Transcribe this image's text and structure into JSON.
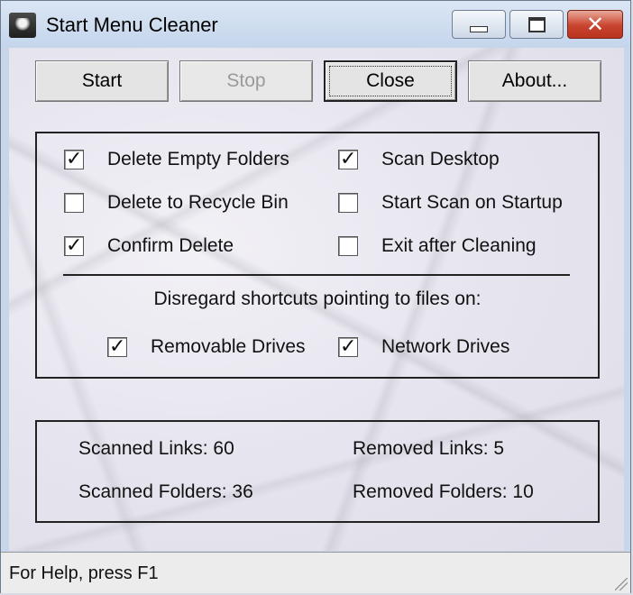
{
  "window": {
    "title": "Start Menu Cleaner",
    "caption_buttons": [
      "minimize-icon",
      "maximize-icon",
      "close-icon"
    ],
    "close_glyph": "✕"
  },
  "toolbar": {
    "start_label": "Start",
    "stop_label": "Stop",
    "close_label": "Close",
    "about_label": "About..."
  },
  "options": {
    "delete_empty_folders": {
      "label": "Delete Empty Folders",
      "checked": true
    },
    "scan_desktop": {
      "label": "Scan Desktop",
      "checked": true
    },
    "delete_to_recycle_bin": {
      "label": "Delete to Recycle Bin",
      "checked": false
    },
    "start_scan_on_startup": {
      "label": "Start Scan on Startup",
      "checked": false
    },
    "confirm_delete": {
      "label": "Confirm Delete",
      "checked": true
    },
    "exit_after_cleaning": {
      "label": "Exit after Cleaning",
      "checked": false
    },
    "disregard_heading": "Disregard shortcuts pointing to files on:",
    "removable_drives": {
      "label": "Removable Drives",
      "checked": true
    },
    "network_drives": {
      "label": "Network Drives",
      "checked": true
    }
  },
  "stats": {
    "scanned_links": "Scanned Links: 60",
    "removed_links": "Removed Links: 5",
    "scanned_folders": "Scanned Folders: 36",
    "removed_folders": "Removed Folders: 10"
  },
  "statusbar": {
    "text": "For Help, press F1"
  }
}
